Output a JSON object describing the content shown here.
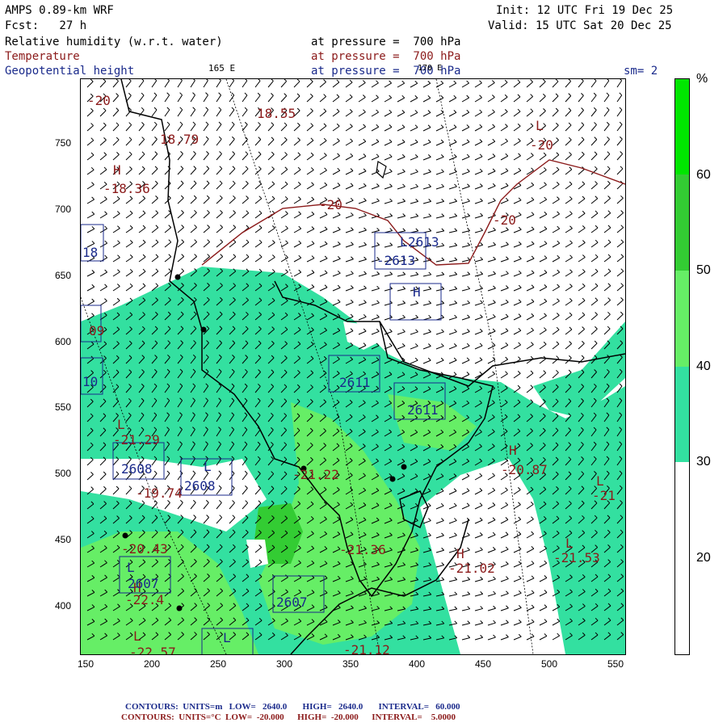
{
  "header": {
    "model": "AMPS 0.89-km WRF",
    "fcst": "Fcst:   27 h",
    "init": "Init: 12 UTC Fri 19 Dec 25",
    "valid": "Valid: 15 UTC Sat 20 Dec 25",
    "field1": "Relative humidity (w.r.t. water)",
    "field2": "Temperature",
    "field3": "Geopotential height",
    "pressure1": "at pressure =  700 hPa",
    "pressure2": "at pressure =  700 hPa",
    "pressure3": "at pressure =  700 hPa",
    "lon_165": "165 E",
    "lon_170": "170 E",
    "smooth": "sm= 2"
  },
  "axes": {
    "x_ticks": [
      "150",
      "200",
      "250",
      "300",
      "350",
      "400",
      "450",
      "500",
      "550"
    ],
    "y_ticks": [
      "750",
      "700",
      "650",
      "600",
      "550",
      "500",
      "450",
      "400"
    ]
  },
  "colorbar": {
    "unit": "%",
    "labels": [
      "60",
      "50",
      "40",
      "30",
      "20"
    ],
    "levels": [
      {
        "from": 60,
        "to": 70,
        "color": "#00e600"
      },
      {
        "from": 50,
        "to": 60,
        "color": "#33cc33"
      },
      {
        "from": 40,
        "to": 50,
        "color": "#66ee66"
      },
      {
        "from": 30,
        "to": 40,
        "color": "#33e0a0"
      },
      {
        "from": 20,
        "to": 30,
        "color": "#ffffff"
      },
      {
        "from": 10,
        "to": 20,
        "color": "#ffffff"
      }
    ]
  },
  "map_labels": {
    "temps": [
      {
        "t": "-20"
      },
      {
        "t": "18.55"
      },
      {
        "t": "18.79"
      },
      {
        "t": "H"
      },
      {
        "t": "-18.36"
      },
      {
        "t": "-20"
      },
      {
        "t": "L"
      },
      {
        "t": "-20"
      },
      {
        "t": "-20"
      },
      {
        "t": "L"
      },
      {
        "t": "-21.29"
      },
      {
        "t": "-19.74"
      },
      {
        "t": "-21.22"
      },
      {
        "t": "H"
      },
      {
        "t": "-20.87"
      },
      {
        "t": "L"
      },
      {
        "t": "-21"
      },
      {
        "t": "-20.43"
      },
      {
        "t": "-21.36"
      },
      {
        "t": "H"
      },
      {
        "t": "-21.02"
      },
      {
        "t": "L"
      },
      {
        "t": "-21.53"
      },
      {
        "t": "H"
      },
      {
        "t": "-22.4"
      },
      {
        "t": "L"
      },
      {
        "t": "-22.57"
      },
      {
        "t": "-21.12"
      }
    ],
    "heights": [
      {
        "t": "2613"
      },
      {
        "t": "L"
      },
      {
        "t": "-2613"
      },
      {
        "t": "H"
      },
      {
        "t": "2611"
      },
      {
        "t": "2611"
      },
      {
        "t": "2608"
      },
      {
        "t": "L"
      },
      {
        "t": "2608"
      },
      {
        "t": "L"
      },
      {
        "t": "2607"
      },
      {
        "t": "2607"
      },
      {
        "t": "L"
      },
      {
        "t": "18"
      },
      {
        "t": "09"
      },
      {
        "t": "10"
      }
    ]
  },
  "footer": {
    "c1": "CONTOURS:  UNITS=m   LOW=   2640.0       HIGH=   2640.0       INTERVAL=   60.000",
    "c2": "CONTOURS:  UNITS=°C  LOW=  -20.000      HIGH=  -20.000      INTERVAL=    5.0000"
  }
}
